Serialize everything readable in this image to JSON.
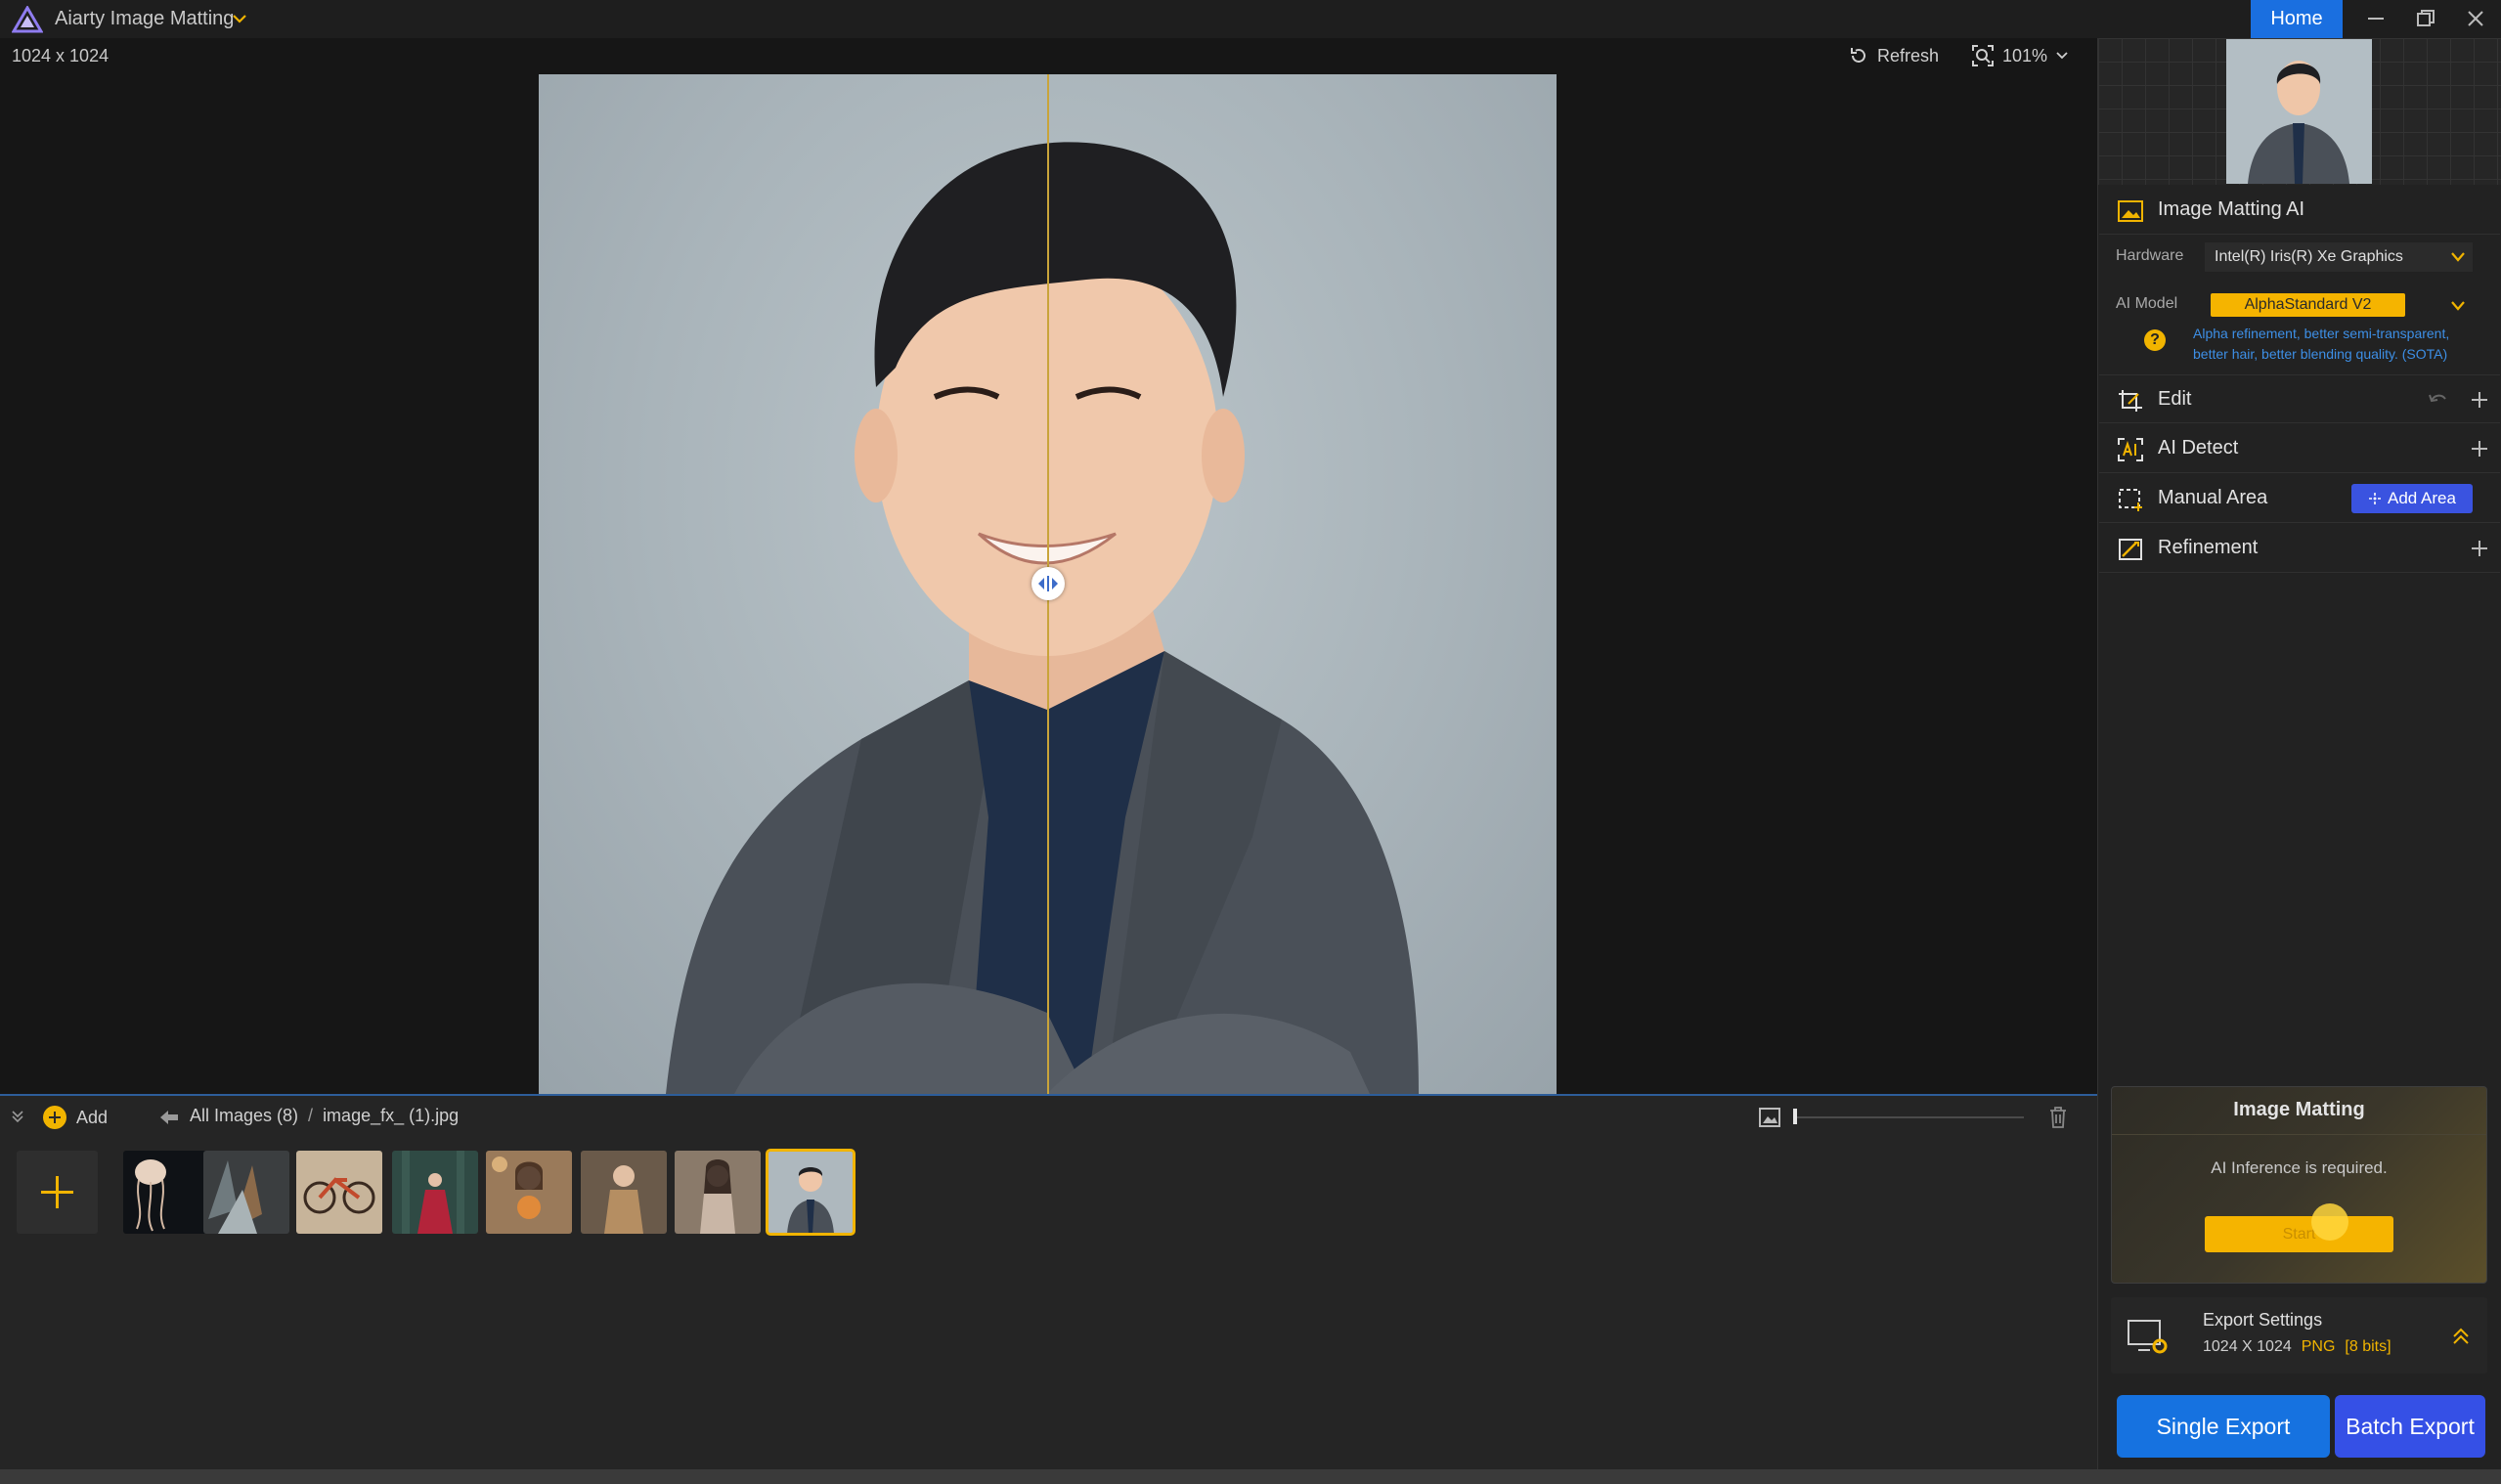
{
  "app": {
    "title": "Aiarty Image Matting",
    "home_label": "Home"
  },
  "canvas": {
    "dimensions": "1024 x 1024",
    "refresh_label": "Refresh",
    "zoom": "101%",
    "split_position": 0.51
  },
  "strip": {
    "add_label": "Add",
    "breadcrumb_root": "All Images (8)",
    "breadcrumb_sep": "/",
    "breadcrumb_file": "image_fx_ (1).jpg",
    "thumbnails": [
      "jellyfish",
      "crystals",
      "bicycle",
      "woman-red-dress",
      "woman-flowers",
      "woman-gold",
      "woman-floral",
      "man-suit"
    ],
    "selected_index": 7,
    "thumb_size": 0.0
  },
  "panel": {
    "ai_section": {
      "title": "Image Matting AI",
      "hardware_label": "Hardware",
      "hardware_value": "Intel(R) Iris(R) Xe Graphics",
      "model_label": "AI Model",
      "model_value": "AlphaStandard  V2",
      "model_description": "Alpha refinement, better semi-transparent, better hair, better blending quality. (SOTA)"
    },
    "edit": {
      "title": "Edit"
    },
    "ai_detect": {
      "title": "AI Detect"
    },
    "manual_area": {
      "title": "Manual Area",
      "add_area_label": "Add Area"
    },
    "refinement": {
      "title": "Refinement"
    },
    "matting": {
      "title": "Image Matting",
      "message": "AI Inference is required.",
      "start_label": "Start"
    },
    "export_settings": {
      "title": "Export Settings",
      "size": "1024 X 1024",
      "format": "PNG",
      "bits": "[8 bits]"
    },
    "single_export_label": "Single Export",
    "batch_export_label": "Batch Export"
  },
  "colors": {
    "accent": "#f5b400",
    "primary_blue": "#1672e0",
    "batch_blue": "#3550e6",
    "link_blue": "#3d8fe6"
  }
}
